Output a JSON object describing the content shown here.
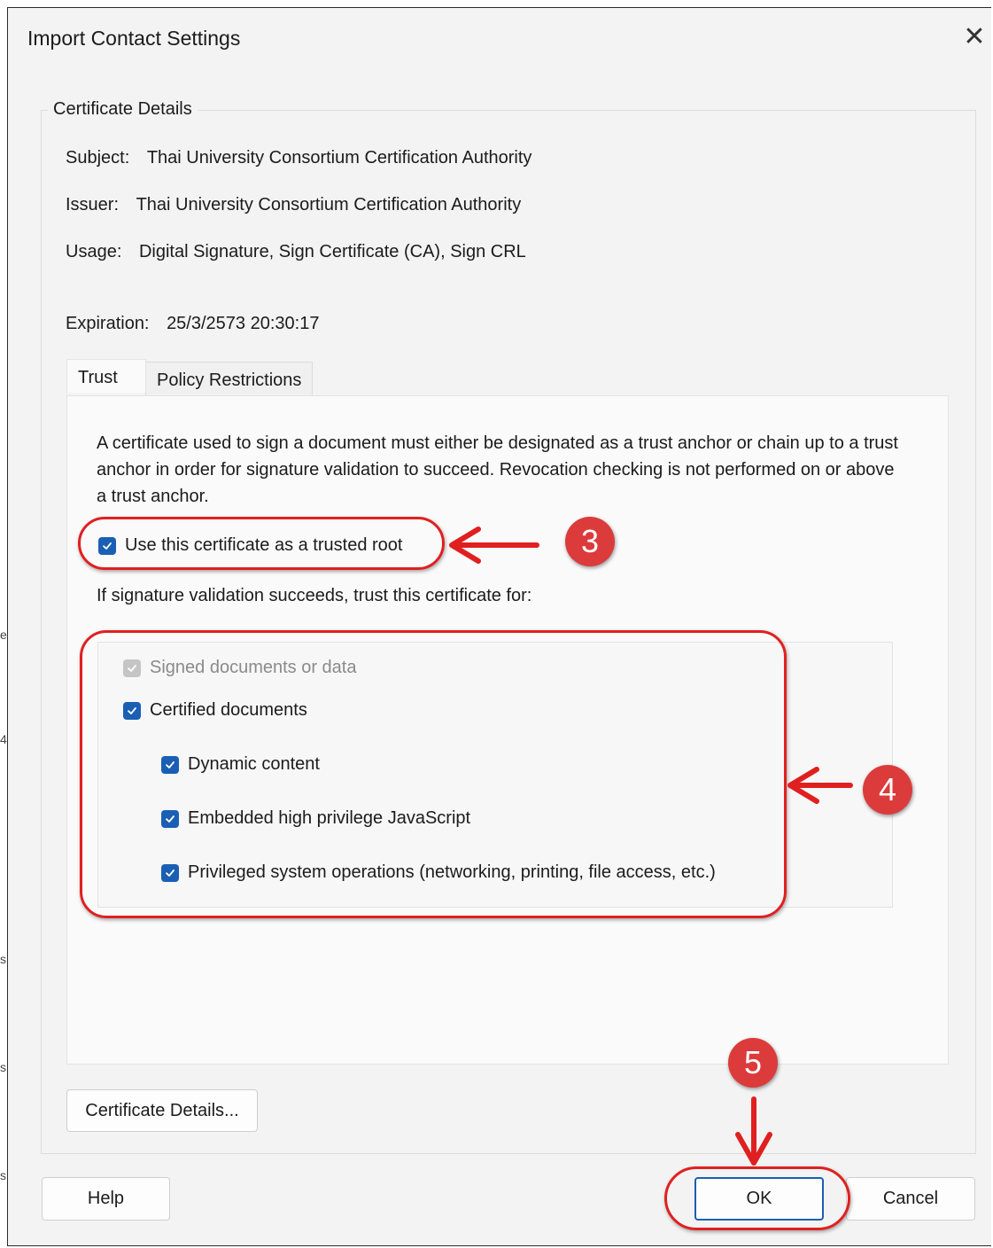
{
  "window": {
    "title": "Import Contact Settings",
    "close_icon": "close-icon"
  },
  "group": {
    "legend": "Certificate Details",
    "subject_label": "Subject:",
    "subject_value": "Thai University Consortium Certification Authority",
    "issuer_label": "Issuer:",
    "issuer_value": "Thai University Consortium Certification Authority",
    "usage_label": "Usage:",
    "usage_value": "Digital Signature, Sign Certificate (CA), Sign CRL",
    "expiration_label": "Expiration:",
    "expiration_value": "25/3/2573 20:30:17"
  },
  "tabs": [
    {
      "label": "Trust",
      "active": true
    },
    {
      "label": "Policy Restrictions",
      "active": false
    }
  ],
  "trust": {
    "description": "A certificate used to sign a document must either be designated as a trust anchor or chain up to a trust anchor in order for signature validation to succeed.  Revocation checking is not performed on or above a trust anchor.",
    "trusted_root": {
      "label": "Use this certificate as a trusted root",
      "checked": true
    },
    "trust_for_label": "If signature validation succeeds, trust this certificate for:",
    "options": [
      {
        "label": "Signed documents or data",
        "checked": true,
        "disabled": true
      },
      {
        "label": "Certified documents",
        "checked": true,
        "disabled": false
      },
      {
        "label": "Dynamic content",
        "checked": true,
        "disabled": false
      },
      {
        "label": "Embedded high privilege JavaScript",
        "checked": true,
        "disabled": false
      },
      {
        "label": "Privileged system operations (networking, printing, file access, etc.)",
        "checked": true,
        "disabled": false
      }
    ]
  },
  "buttons": {
    "certificate_details": "Certificate Details...",
    "help": "Help",
    "ok": "OK",
    "cancel": "Cancel"
  },
  "annotations": {
    "step3": "3",
    "step4": "4",
    "step5": "5",
    "color": "#e02020",
    "badge_color": "#dc3b3b"
  },
  "side_glyphs": [
    "e",
    "4",
    "s",
    "s",
    "s"
  ]
}
